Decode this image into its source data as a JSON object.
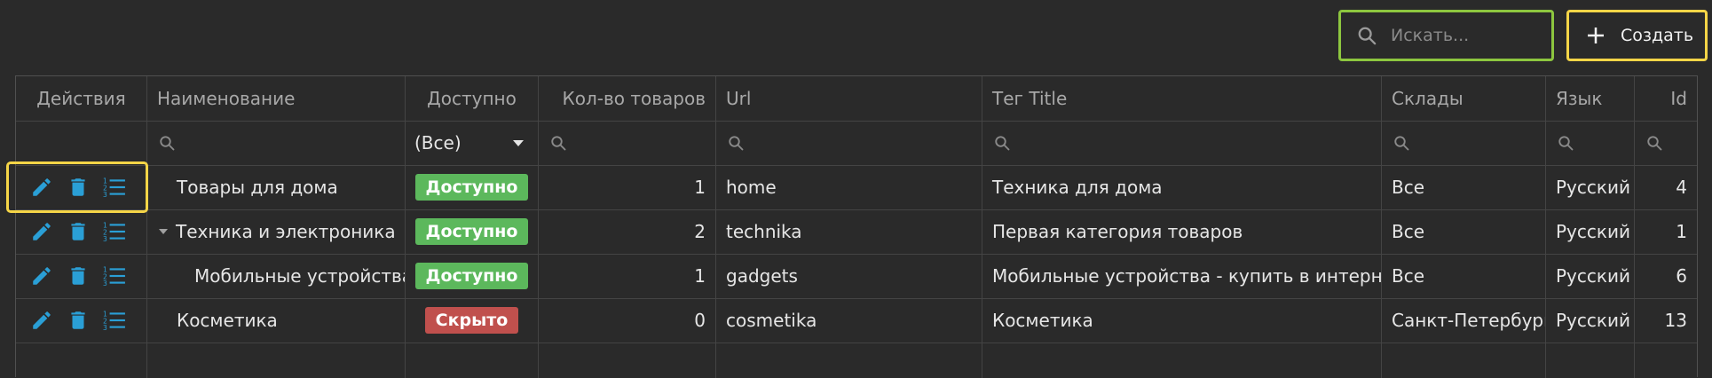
{
  "toolbar": {
    "search_placeholder": "Искать...",
    "create_label": "Создать"
  },
  "columns": {
    "actions": "Действия",
    "name": "Наименование",
    "available": "Доступно",
    "count": "Кол-во товаров",
    "url": "Url",
    "title": "Тег Title",
    "stores": "Склады",
    "lang": "Язык",
    "id": "Id"
  },
  "filters": {
    "available_value": "(Все)"
  },
  "rows": [
    {
      "name": "Товары для дома",
      "status": "Доступно",
      "count": "1",
      "url": "home",
      "title": "Техника для дома",
      "stores": "Все",
      "lang": "Русский",
      "id": "4"
    },
    {
      "name": "Техника и электроника",
      "status": "Доступно",
      "count": "2",
      "url": "technika",
      "title": "Первая категория товаров",
      "stores": "Все",
      "lang": "Русский",
      "id": "1"
    },
    {
      "name": "Мобильные устройства",
      "status": "Доступно",
      "count": "1",
      "url": "gadgets",
      "title": "Мобильные устройства - купить в интерне...",
      "stores": "Все",
      "lang": "Русский",
      "id": "6"
    },
    {
      "name": "Косметика",
      "status": "Скрыто",
      "count": "0",
      "url": "cosmetika",
      "title": "Косметика",
      "stores": "Санкт-Петербург",
      "lang": "Русский",
      "id": "13"
    }
  ],
  "colors": {
    "accent_blue": "#2a9fd6",
    "available_green": "#5cb85c",
    "hidden_red": "#c0504d",
    "highlight_yellow": "#f5d547",
    "highlight_green": "#8dc63f"
  },
  "icons": [
    "search-icon",
    "plus-icon",
    "edit-icon",
    "delete-icon",
    "list-icon",
    "filter-search-icon",
    "dropdown-caret-icon",
    "tree-expand-icon"
  ]
}
